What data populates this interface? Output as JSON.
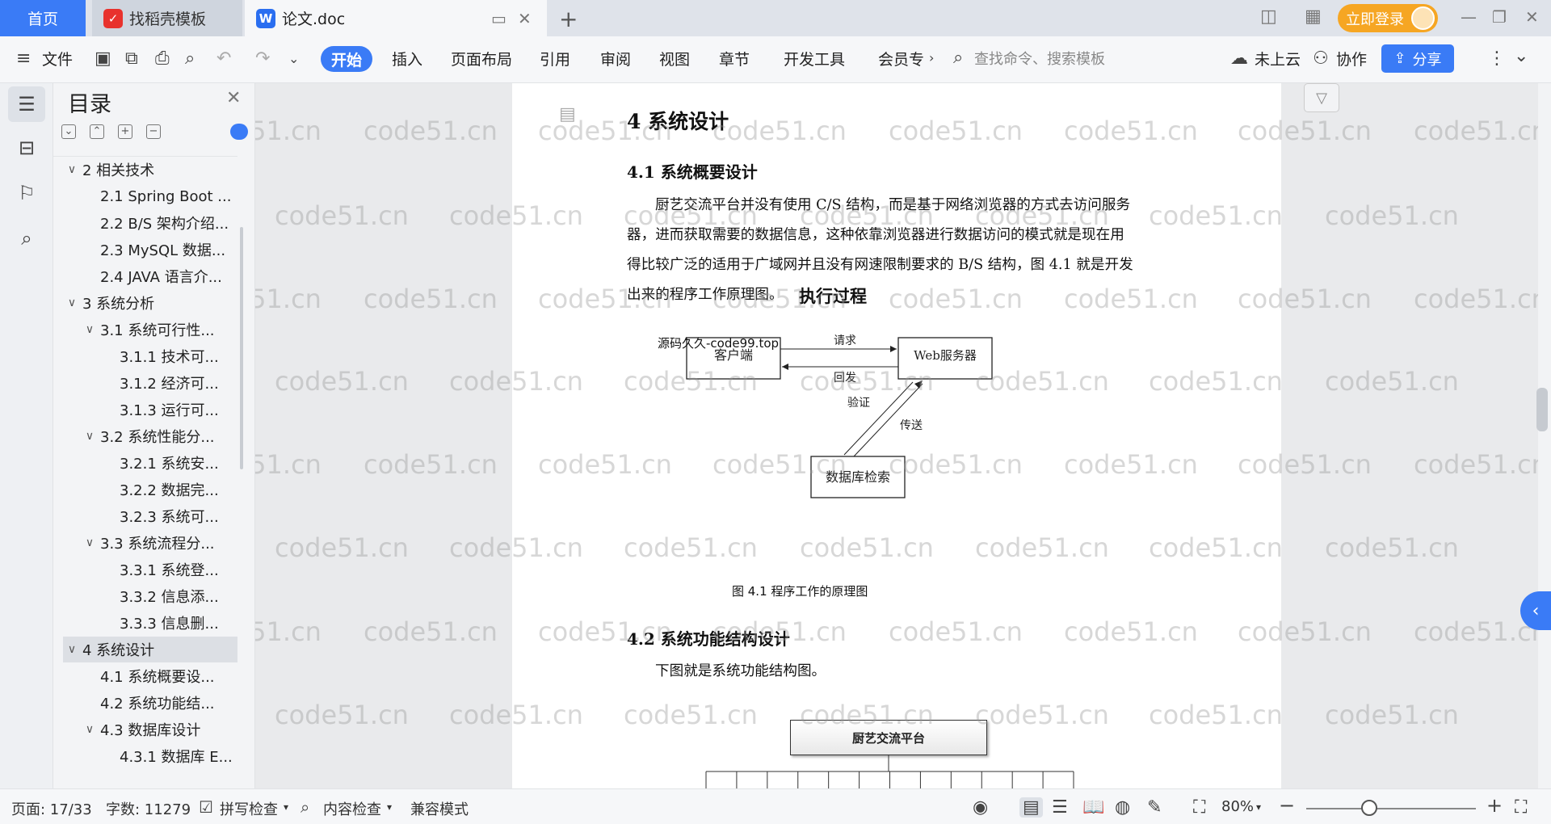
{
  "tabs": {
    "home": "首页",
    "template": "找稻壳模板",
    "doc": "论文.doc"
  },
  "header": {
    "login_label": "立即登录"
  },
  "toolbar": {
    "file": "文件",
    "start": "开始",
    "insert": "插入",
    "layout": "页面布局",
    "reference": "引用",
    "review": "审阅",
    "view": "视图",
    "chapter": "章节",
    "devtools": "开发工具",
    "member": "会员专",
    "search_placeholder": "查找命令、搜索模板",
    "cloud": "未上云",
    "collab": "协作",
    "share": "分享"
  },
  "toc": {
    "title": "目录",
    "items": [
      {
        "label": "2  相关技术",
        "level": 1,
        "chev": "v"
      },
      {
        "label": "2.1 Spring Boot ...",
        "level": 2,
        "chev": ""
      },
      {
        "label": "2.2 B/S 架构介绍...",
        "level": 2,
        "chev": ""
      },
      {
        "label": "2.3 MySQL 数据...",
        "level": 2,
        "chev": ""
      },
      {
        "label": "2.4 JAVA 语言介...",
        "level": 2,
        "chev": ""
      },
      {
        "label": "3  系统分析",
        "level": 1,
        "chev": "v"
      },
      {
        "label": "3.1 系统可行性...",
        "level": 2,
        "chev": "v"
      },
      {
        "label": "3.1.1  技术可...",
        "level": 3,
        "chev": ""
      },
      {
        "label": "3.1.2  经济可...",
        "level": 3,
        "chev": ""
      },
      {
        "label": "3.1.3  运行可...",
        "level": 3,
        "chev": ""
      },
      {
        "label": "3.2 系统性能分...",
        "level": 2,
        "chev": "v"
      },
      {
        "label": "3.2.1  系统安...",
        "level": 3,
        "chev": ""
      },
      {
        "label": "3.2.2  数据完...",
        "level": 3,
        "chev": ""
      },
      {
        "label": "3.2.3 系统可...",
        "level": 3,
        "chev": ""
      },
      {
        "label": "3.3 系统流程分...",
        "level": 2,
        "chev": "v"
      },
      {
        "label": "3.3.1 系统登...",
        "level": 3,
        "chev": ""
      },
      {
        "label": "3.3.2 信息添...",
        "level": 3,
        "chev": ""
      },
      {
        "label": "3.3.3 信息删...",
        "level": 3,
        "chev": ""
      },
      {
        "label": "4  系统设计",
        "level": 1,
        "chev": "v",
        "active": true
      },
      {
        "label": "4.1 系统概要设...",
        "level": 2,
        "chev": ""
      },
      {
        "label": "4.2 系统功能结...",
        "level": 2,
        "chev": ""
      },
      {
        "label": "4.3 数据库设计",
        "level": 2,
        "chev": "v"
      },
      {
        "label": "4.3.1 数据库 E...",
        "level": 3,
        "chev": ""
      }
    ]
  },
  "document": {
    "h1": "4  系统设计",
    "h2_1": "4.1 系统概要设计",
    "para_lines": [
      "厨艺交流平台并没有使用 C/S 结构，而是基于网络浏览器的方式去访问服务",
      "器，进而获取需要的数据信息，这种依靠浏览器进行数据访问的模式就是现在用",
      "得比较广泛的适用于广域网并且没有网速限制要求的 B/S 结构，图 4.1 就是开发",
      "出来的程序工作原理图。"
    ],
    "diagram": {
      "title": "执行过程",
      "client": "客户端",
      "server": "Web服务器",
      "db": "数据库检索",
      "request": "请求",
      "reply": "回发",
      "verify": "验证",
      "transfer": "传送",
      "overlay": "源码久久-code99.top",
      "caption": "图 4.1  程序工作的原理图"
    },
    "h2_2": "4.2 系统功能结构设计",
    "para2": "下图就是系统功能结构图。",
    "struct_root": "厨艺交流平台",
    "watermark": "code51.cn"
  },
  "status": {
    "page": "页面: 17/33",
    "words": "字数: 11279",
    "spell": "拼写检查",
    "content_check": "内容检查",
    "compat": "兼容模式",
    "zoom": "80%"
  },
  "colors": {
    "accent": "#3a7bf6",
    "login": "#f6a623"
  }
}
